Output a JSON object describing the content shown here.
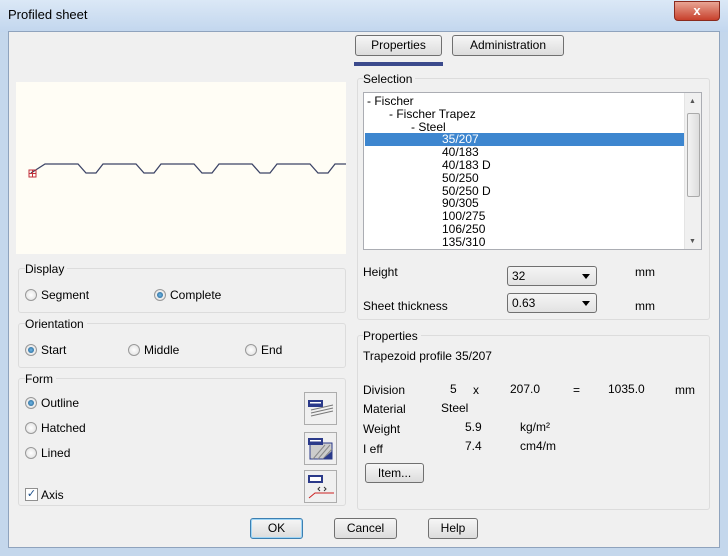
{
  "window": {
    "title": "Profiled sheet",
    "close": "x"
  },
  "tabs": [
    {
      "label": "Properties",
      "active": true
    },
    {
      "label": "Administration",
      "active": false
    }
  ],
  "display": {
    "label": "Display",
    "options": [
      "Segment",
      "Complete"
    ],
    "selected": "Complete"
  },
  "orientation": {
    "label": "Orientation",
    "options": [
      "Start",
      "Middle",
      "End"
    ],
    "selected": "Start"
  },
  "form": {
    "label": "Form",
    "options": [
      "Outline",
      "Hatched",
      "Lined"
    ],
    "selected": "Outline",
    "axis_label": "Axis",
    "axis_checked": true
  },
  "selection": {
    "label": "Selection",
    "tree": [
      {
        "text": "- Fischer",
        "level": 0
      },
      {
        "text": "- Fischer Trapez",
        "level": 1
      },
      {
        "text": "- Steel",
        "level": 2
      },
      {
        "text": "35/207",
        "level": 3,
        "selected": true
      },
      {
        "text": "40/183",
        "level": 3
      },
      {
        "text": "40/183 D",
        "level": 3
      },
      {
        "text": "50/250",
        "level": 3
      },
      {
        "text": "50/250 D",
        "level": 3
      },
      {
        "text": "90/305",
        "level": 3
      },
      {
        "text": "100/275",
        "level": 3
      },
      {
        "text": "106/250",
        "level": 3
      },
      {
        "text": "135/310",
        "level": 3
      }
    ],
    "height_label": "Height",
    "height_value": "32",
    "height_unit": "mm",
    "thickness_label": "Sheet thickness",
    "thickness_value": "0.63",
    "thickness_unit": "mm"
  },
  "properties": {
    "label": "Properties",
    "profile_name": "Trapezoid profile 35/207",
    "division_label": "Division",
    "division_count": "5",
    "times": "x",
    "division_width": "207.0",
    "equals": "=",
    "division_total": "1035.0",
    "division_unit": "mm",
    "material_label": "Material",
    "material_value": "Steel",
    "weight_label": "Weight",
    "weight_value": "5.9",
    "weight_unit": "kg/m²",
    "ieff_label": "I eff",
    "ieff_value": "7.4",
    "ieff_unit": "cm4/m",
    "item_button": "Item..."
  },
  "buttons": {
    "ok": "OK",
    "cancel": "Cancel",
    "help": "Help"
  },
  "colors": {
    "accent": "#3b4a8c",
    "selection": "#3d86cf",
    "profile_line": "#3c4466"
  }
}
